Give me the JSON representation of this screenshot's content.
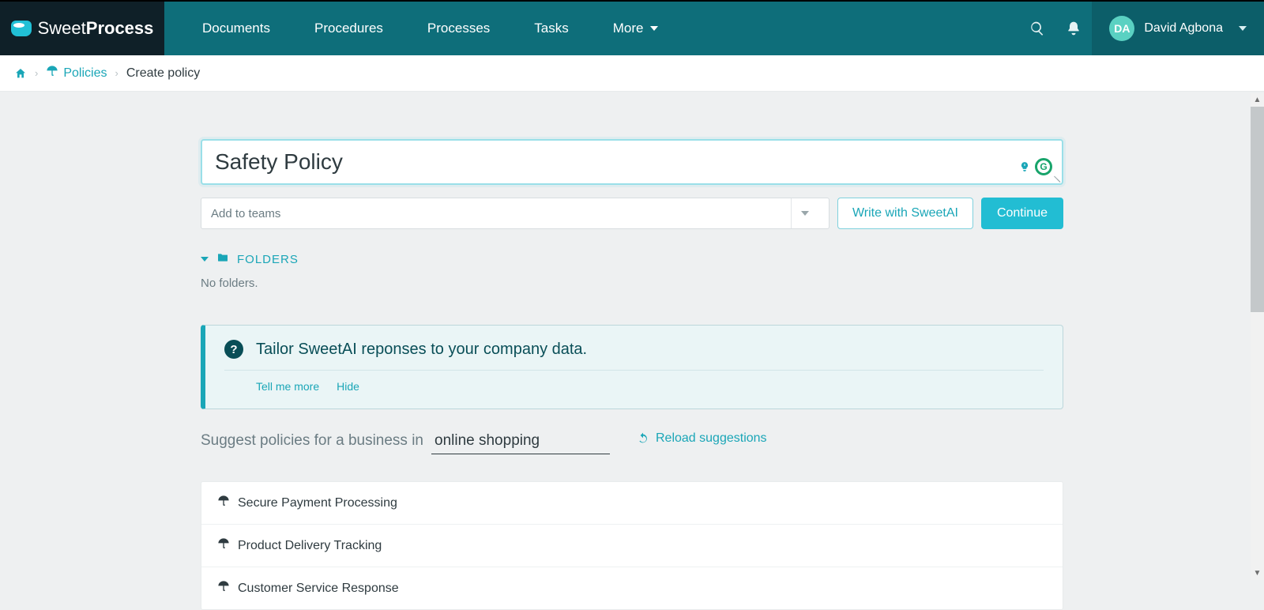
{
  "brand": {
    "thin": "Sweet",
    "bold": "Process"
  },
  "nav": {
    "items": [
      "Documents",
      "Procedures",
      "Processes",
      "Tasks"
    ],
    "more": "More"
  },
  "user": {
    "initials": "DA",
    "name": "David Agbona"
  },
  "breadcrumb": {
    "home": "Home",
    "policies": "Policies",
    "current": "Create policy"
  },
  "title": {
    "value": "Safety Policy"
  },
  "teams": {
    "placeholder": "Add to teams"
  },
  "buttons": {
    "ai": "Write with SweetAI",
    "continue": "Continue"
  },
  "folders": {
    "label": "FOLDERS",
    "empty": "No folders."
  },
  "panel": {
    "headline": "Tailor SweetAI reponses to your company data.",
    "tell": "Tell me more",
    "hide": "Hide"
  },
  "suggest": {
    "lead": "Suggest policies for a business in",
    "value": "online shopping",
    "reload": "Reload suggestions"
  },
  "suggestions": [
    "Secure Payment Processing",
    "Product Delivery Tracking",
    "Customer Service Response"
  ],
  "colors": {
    "teal": "#0e6e7a",
    "link": "#1aa6b7",
    "primary": "#22bdd3"
  }
}
